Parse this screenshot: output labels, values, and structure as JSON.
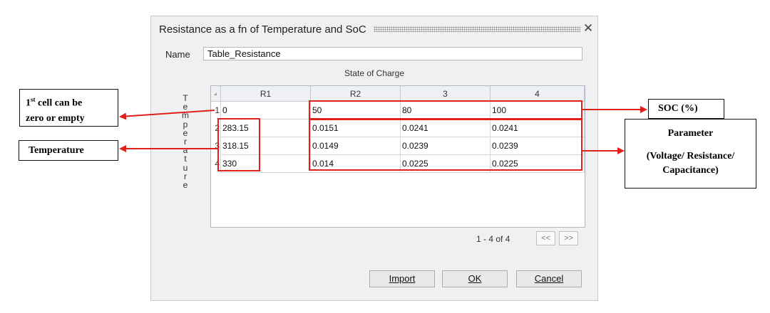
{
  "dialog": {
    "title": "Resistance as a fn of Temperature and SoC",
    "close_icon": "close-icon",
    "name_label": "Name",
    "name_value": "Table_Resistance",
    "column_group_label": "State of Charge",
    "row_group_label": [
      "T",
      "e",
      "m",
      "p",
      "e",
      "r",
      "a",
      "t",
      "u",
      "r",
      "e"
    ]
  },
  "table": {
    "headers": [
      "R1",
      "R2",
      "3",
      "4"
    ],
    "rows": [
      {
        "num": "1",
        "cells": [
          "0",
          "50",
          "80",
          "100"
        ]
      },
      {
        "num": "2",
        "cells": [
          "283.15",
          "0.0151",
          "0.0241",
          "0.0241"
        ]
      },
      {
        "num": "3",
        "cells": [
          "318.15",
          "0.0149",
          "0.0239",
          "0.0239"
        ]
      },
      {
        "num": "4",
        "cells": [
          "330",
          "0.014",
          "0.0225",
          "0.0225"
        ]
      }
    ]
  },
  "pagination": {
    "text": "1 - 4 of 4",
    "prev_label": "<<",
    "next_label": ">>"
  },
  "buttons": {
    "import": "Import",
    "ok": "OK",
    "cancel": "Cancel"
  },
  "annotations": {
    "first_cell": {
      "sup_prefix": "1",
      "sup": "st",
      "line1_rest": " cell can be",
      "line2": "zero or empty"
    },
    "temperature": "Temperature",
    "soc": "SOC (%)",
    "parameter": {
      "line1": "Parameter",
      "line2": "(Voltage/ Resistance/",
      "line3": "Capacitance)"
    }
  },
  "colors": {
    "highlight": "#e0201b",
    "dialog_bg": "#f0f0f0",
    "grid_border": "#aeb7c2"
  }
}
